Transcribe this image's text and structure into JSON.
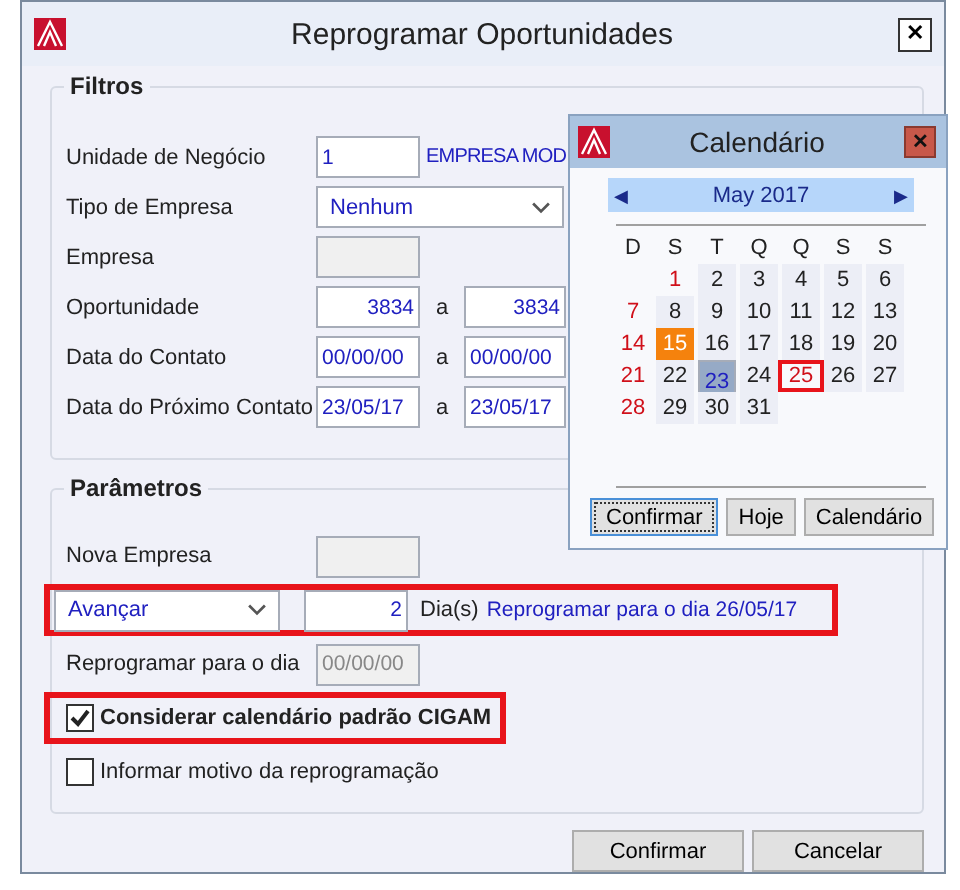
{
  "window": {
    "title": "Reprogramar Oportunidades",
    "close": "✕"
  },
  "filtros": {
    "title": "Filtros",
    "rows": [
      {
        "kind": "lookup",
        "label": "Unidade de Negócio",
        "value": "1",
        "description": "EMPRESA MOD"
      },
      {
        "kind": "select",
        "label": "Tipo de Empresa",
        "value": "Nenhum"
      },
      {
        "kind": "disabled",
        "label": "Empresa"
      },
      {
        "kind": "number_range",
        "label": "Oportunidade",
        "from": "3834",
        "sep": "a",
        "to": "3834"
      },
      {
        "kind": "date_range",
        "label": "Data do Contato",
        "from": "00/00/00",
        "sep": "a",
        "to": "00/00/00"
      },
      {
        "kind": "date_range",
        "label": "Data do Próximo Contato",
        "from": "23/05/17",
        "sep": "a",
        "to": "23/05/17"
      }
    ]
  },
  "parametros": {
    "title": "Parâmetros",
    "rows": [
      {
        "kind": "disabled",
        "label": "Nova Empresa",
        "highlighted": false
      },
      {
        "kind": "advance",
        "select": "Avançar",
        "days": "2",
        "unit": "Dia(s)",
        "result": "Reprogramar para o dia 26/05/17",
        "highlighted": true
      },
      {
        "kind": "date",
        "label": "Reprogramar para o dia",
        "value": "00/00/00",
        "highlighted": false
      },
      {
        "kind": "checkbox",
        "label": "Considerar calendário padrão CIGAM",
        "checked": true,
        "highlighted": true
      },
      {
        "kind": "checkbox",
        "label": "Informar motivo da reprogramação",
        "checked": false,
        "highlighted": false
      }
    ]
  },
  "buttons": [
    "Confirmar",
    "Cancelar"
  ],
  "calendar": {
    "title": "Calendário",
    "close": "✕",
    "month": "May 2017",
    "prev": "◀",
    "next": "▶",
    "weekdays": [
      "D",
      "S",
      "T",
      "Q",
      "Q",
      "S",
      "S"
    ],
    "weeks": [
      [
        {
          "kind": "blank"
        },
        {
          "day": "1",
          "kind": "holiday"
        },
        {
          "day": "2",
          "kind": "weekday"
        },
        {
          "day": "3",
          "kind": "weekday"
        },
        {
          "day": "4",
          "kind": "weekday"
        },
        {
          "day": "5",
          "kind": "weekday"
        },
        {
          "day": "6",
          "kind": "weekday"
        }
      ],
      [
        {
          "day": "7",
          "kind": "sunday"
        },
        {
          "day": "8",
          "kind": "weekday"
        },
        {
          "day": "9",
          "kind": "weekday"
        },
        {
          "day": "10",
          "kind": "weekday"
        },
        {
          "day": "11",
          "kind": "weekday"
        },
        {
          "day": "12",
          "kind": "weekday"
        },
        {
          "day": "13",
          "kind": "weekday"
        }
      ],
      [
        {
          "day": "14",
          "kind": "sunday"
        },
        {
          "day": "15",
          "kind": "today"
        },
        {
          "day": "16",
          "kind": "weekday"
        },
        {
          "day": "17",
          "kind": "weekday"
        },
        {
          "day": "18",
          "kind": "weekday"
        },
        {
          "day": "19",
          "kind": "weekday"
        },
        {
          "day": "20",
          "kind": "weekday"
        }
      ],
      [
        {
          "day": "21",
          "kind": "sunday"
        },
        {
          "day": "22",
          "kind": "weekday"
        },
        {
          "day": "23",
          "kind": "selected"
        },
        {
          "day": "24",
          "kind": "weekday"
        },
        {
          "day": "25",
          "kind": "target"
        },
        {
          "day": "26",
          "kind": "weekday"
        },
        {
          "day": "27",
          "kind": "weekday"
        }
      ],
      [
        {
          "day": "28",
          "kind": "sunday"
        },
        {
          "day": "29",
          "kind": "weekday"
        },
        {
          "day": "30",
          "kind": "weekday"
        },
        {
          "day": "31",
          "kind": "weekday"
        }
      ]
    ],
    "buttons": [
      {
        "label": "Confirmar",
        "focused": true
      },
      {
        "label": "Hoje",
        "focused": false
      },
      {
        "label": "Calendário",
        "focused": false
      }
    ]
  }
}
